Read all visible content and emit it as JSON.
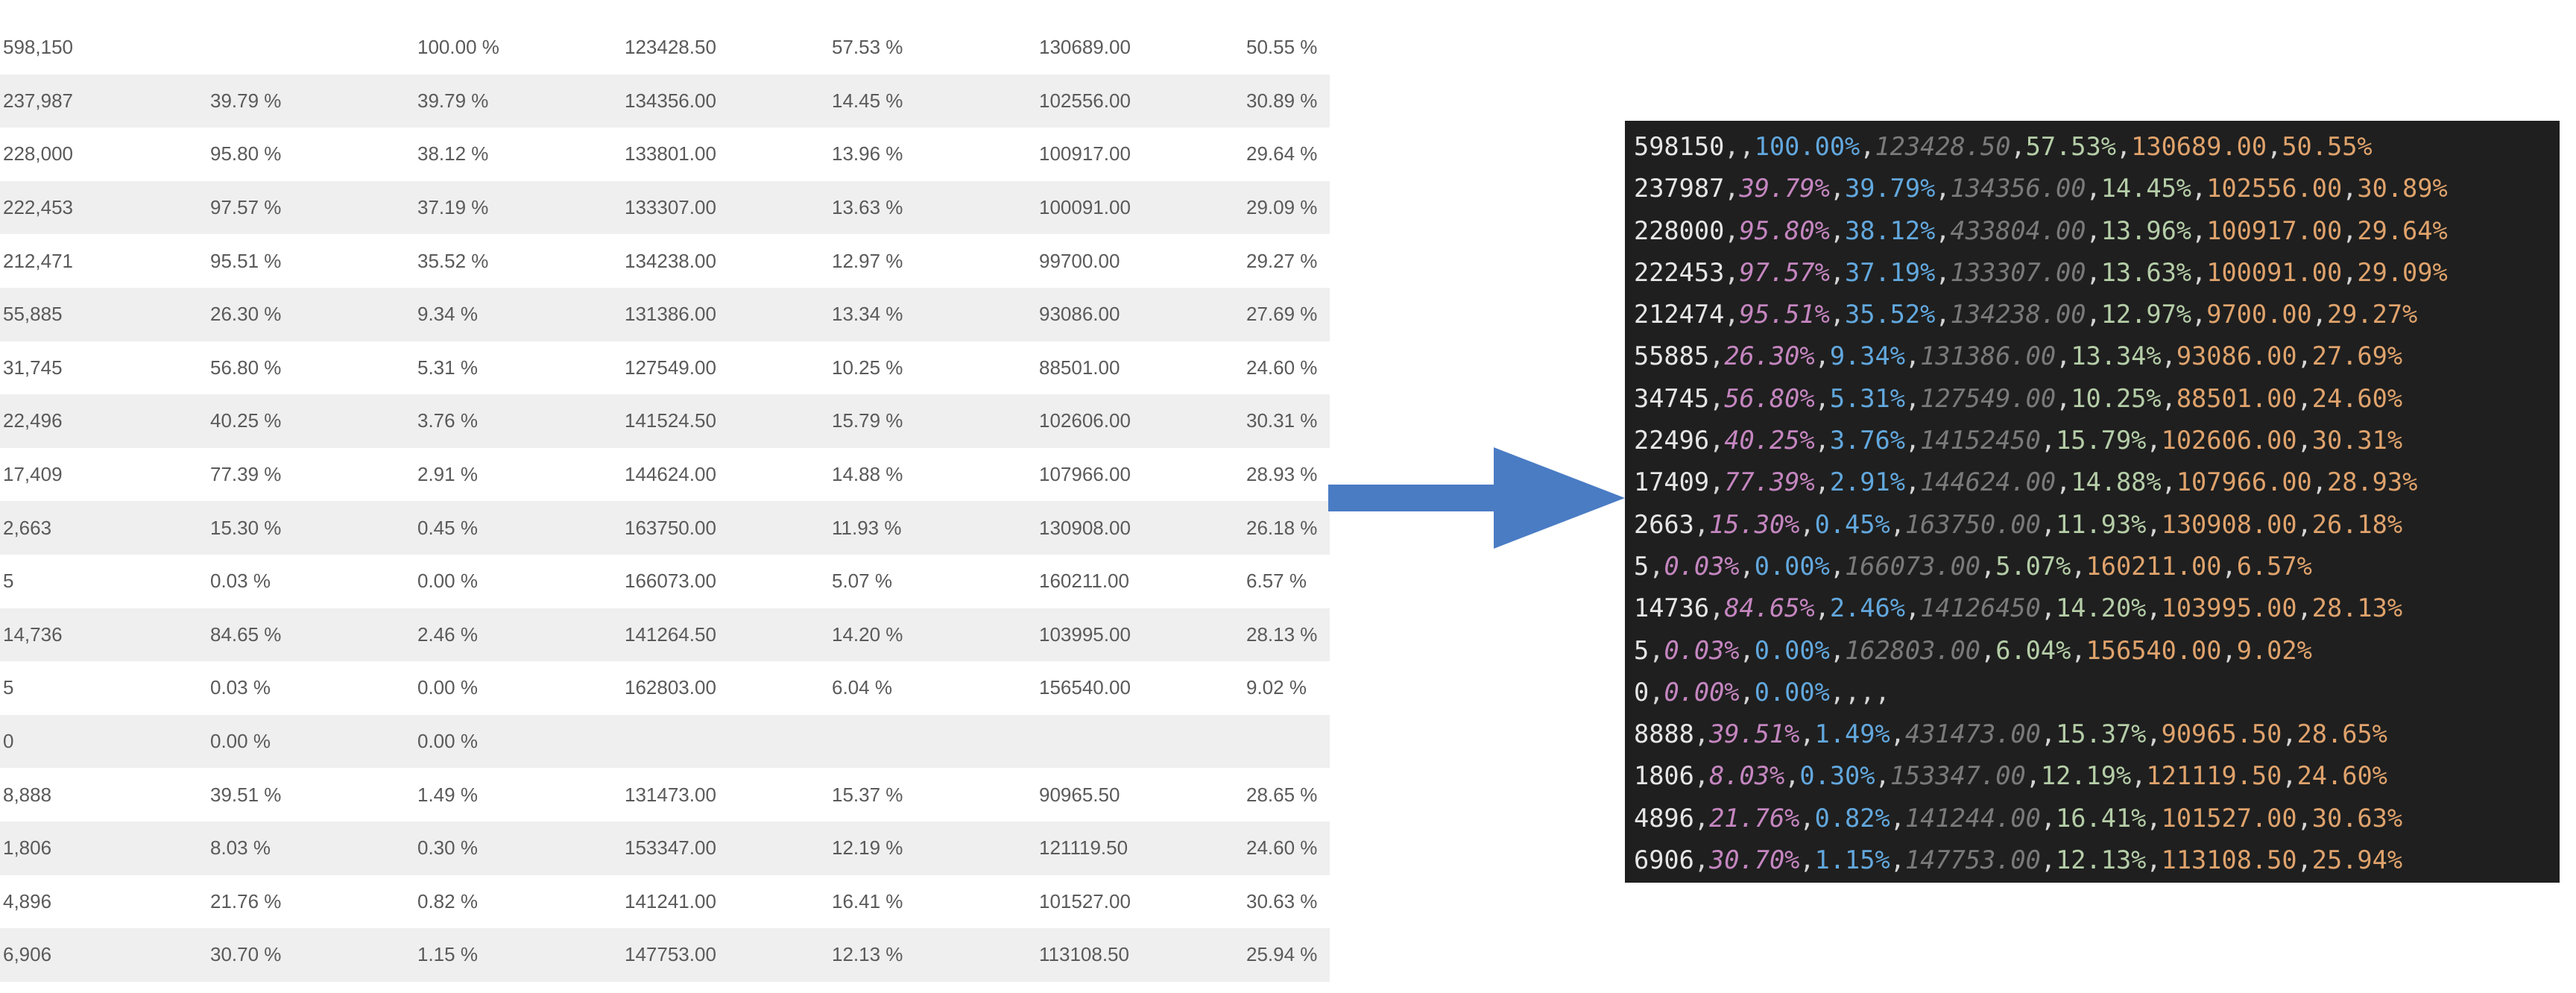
{
  "table": {
    "rows": [
      [
        "598,150",
        "",
        "100.00 %",
        "123428.50",
        "57.53 %",
        "130689.00",
        "50.55 %"
      ],
      [
        "237,987",
        "39.79 %",
        "39.79 %",
        "134356.00",
        "14.45 %",
        "102556.00",
        "30.89 %"
      ],
      [
        "228,000",
        "95.80 %",
        "38.12 %",
        "133801.00",
        "13.96 %",
        "100917.00",
        "29.64 %"
      ],
      [
        "222,453",
        "97.57 %",
        "37.19 %",
        "133307.00",
        "13.63 %",
        "100091.00",
        "29.09 %"
      ],
      [
        "212,471",
        "95.51 %",
        "35.52 %",
        "134238.00",
        "12.97 %",
        "99700.00",
        "29.27 %"
      ],
      [
        "55,885",
        "26.30 %",
        "9.34 %",
        "131386.00",
        "13.34 %",
        "93086.00",
        "27.69 %"
      ],
      [
        "31,745",
        "56.80 %",
        "5.31 %",
        "127549.00",
        "10.25 %",
        "88501.00",
        "24.60 %"
      ],
      [
        "22,496",
        "40.25 %",
        "3.76 %",
        "141524.50",
        "15.79 %",
        "102606.00",
        "30.31 %"
      ],
      [
        "17,409",
        "77.39 %",
        "2.91 %",
        "144624.00",
        "14.88 %",
        "107966.00",
        "28.93 %"
      ],
      [
        "2,663",
        "15.30 %",
        "0.45 %",
        "163750.00",
        "11.93 %",
        "130908.00",
        "26.18 %"
      ],
      [
        "5",
        "0.03 %",
        "0.00 %",
        "166073.00",
        "5.07 %",
        "160211.00",
        "6.57 %"
      ],
      [
        "14,736",
        "84.65 %",
        "2.46 %",
        "141264.50",
        "14.20 %",
        "103995.00",
        "28.13 %"
      ],
      [
        "5",
        "0.03 %",
        "0.00 %",
        "162803.00",
        "6.04 %",
        "156540.00",
        "9.02 %"
      ],
      [
        "0",
        "0.00 %",
        "0.00 %",
        "",
        "",
        "",
        ""
      ],
      [
        "8,888",
        "39.51 %",
        "1.49 %",
        "131473.00",
        "15.37 %",
        "90965.50",
        "28.65 %"
      ],
      [
        "1,806",
        "8.03 %",
        "0.30 %",
        "153347.00",
        "12.19 %",
        "121119.50",
        "24.60 %"
      ],
      [
        "4,896",
        "21.76 %",
        "0.82 %",
        "141241.00",
        "16.41 %",
        "101527.00",
        "30.63 %"
      ],
      [
        "6,906",
        "30.70 %",
        "1.15 %",
        "147753.00",
        "12.13 %",
        "113108.50",
        "25.94 %"
      ]
    ]
  },
  "arrow": {
    "color": "#4a7cc4",
    "icon": "right-arrow-icon"
  },
  "code": {
    "lines": [
      [
        "598150",
        "",
        "100.00%",
        "123428.50",
        "57.53%",
        "130689.00",
        "50.55%"
      ],
      [
        "237987",
        "39.79%",
        "39.79%",
        "134356.00",
        "14.45%",
        "102556.00",
        "30.89%"
      ],
      [
        "228000",
        "95.80%",
        "38.12%",
        "433804.00",
        "13.96%",
        "100917.00",
        "29.64%"
      ],
      [
        "222453",
        "97.57%",
        "37.19%",
        "133307.00",
        "13.63%",
        "100091.00",
        "29.09%"
      ],
      [
        "212474",
        "95.51%",
        "35.52%",
        "134238.00",
        "12.97%",
        "9700.00",
        "29.27%"
      ],
      [
        "55885",
        "26.30%",
        "9.34%",
        "131386.00",
        "13.34%",
        "93086.00",
        "27.69%"
      ],
      [
        "34745",
        "56.80%",
        "5.31%",
        "127549.00",
        "10.25%",
        "88501.00",
        "24.60%"
      ],
      [
        "22496",
        "40.25%",
        "3.76%",
        "14152450",
        "15.79%",
        "102606.00",
        "30.31%"
      ],
      [
        "17409",
        "77.39%",
        "2.91%",
        "144624.00",
        "14.88%",
        "107966.00",
        "28.93%"
      ],
      [
        "2663",
        "15.30%",
        "0.45%",
        "163750.00",
        "11.93%",
        "130908.00",
        "26.18%"
      ],
      [
        "5",
        "0.03%",
        "0.00%",
        "166073.00",
        "5.07%",
        "160211.00",
        "6.57%"
      ],
      [
        "14736",
        "84.65%",
        "2.46%",
        "14126450",
        "14.20%",
        "103995.00",
        "28.13%"
      ],
      [
        "5",
        "0.03%",
        "0.00%",
        "162803.00",
        "6.04%",
        "156540.00",
        "9.02%"
      ],
      [
        "0",
        "0.00%",
        "0.00%",
        "",
        "",
        "",
        ""
      ],
      [
        "8888",
        "39.51%",
        "1.49%",
        "431473.00",
        "15.37%",
        "90965.50",
        "28.65%"
      ],
      [
        "1806",
        "8.03%",
        "0.30%",
        "153347.00",
        "12.19%",
        "121119.50",
        "24.60%"
      ],
      [
        "4896",
        "21.76%",
        "0.82%",
        "141244.00",
        "16.41%",
        "101527.00",
        "30.63%"
      ],
      [
        "6906",
        "30.70%",
        "1.15%",
        "147753.00",
        "12.13%",
        "113108.50",
        "25.94%"
      ]
    ]
  }
}
